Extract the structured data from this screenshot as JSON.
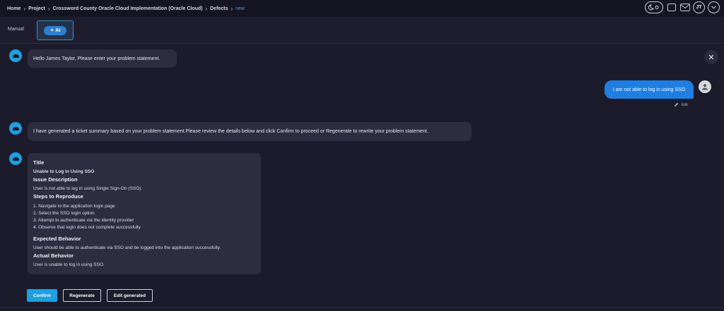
{
  "breadcrumb": {
    "items": [
      "Home",
      "Project",
      "Crossword County Oracle Cloud Implementation (Oracle Cloud)",
      "Defects"
    ],
    "current": "new",
    "separator": "›"
  },
  "header": {
    "user_initials": "JT"
  },
  "modes": {
    "manual_label": "Manual",
    "ai_label": "✦ AI"
  },
  "chat": {
    "greeting": "Hello James Taylor, Please enter your problem statement.",
    "user_message": "I am not able to log in using SSO",
    "edit_label": "Edit",
    "bot_summary_intro": "I have generated a ticket summary based on your problem statement.Please review the details below and click Confirm to proceed or Regenerate to rewrite your problem statement."
  },
  "summary": {
    "title_heading": "Title",
    "title_value": "Unable to Log In Using SSO",
    "issue_heading": "Issue Description",
    "issue_value": "User is not able to log in using Single Sign-On (SSO).",
    "steps_heading": "Steps to Reproduce",
    "steps": [
      "1. Navigate to the application login page",
      "2. Select the SSO login option",
      "3. Attempt to authenticate via the identity provider",
      "4. Observe that login does not complete successfully"
    ],
    "expected_heading": "Expected Behavior",
    "expected_value": "User should be able to authenticate via SSO and be logged into the application successfully.",
    "actual_heading": "Actual Behavior",
    "actual_value": "User is unable to log in using SSO."
  },
  "actions": {
    "confirm_label": "Confirm",
    "regenerate_label": "Regenerate",
    "edit_generated_label": "Edit generated"
  },
  "colors": {
    "background": "#1c1b2b",
    "accent": "#1e9fe0",
    "user_bubble": "#1f7ee0",
    "bubble": "#2e2d3f"
  }
}
